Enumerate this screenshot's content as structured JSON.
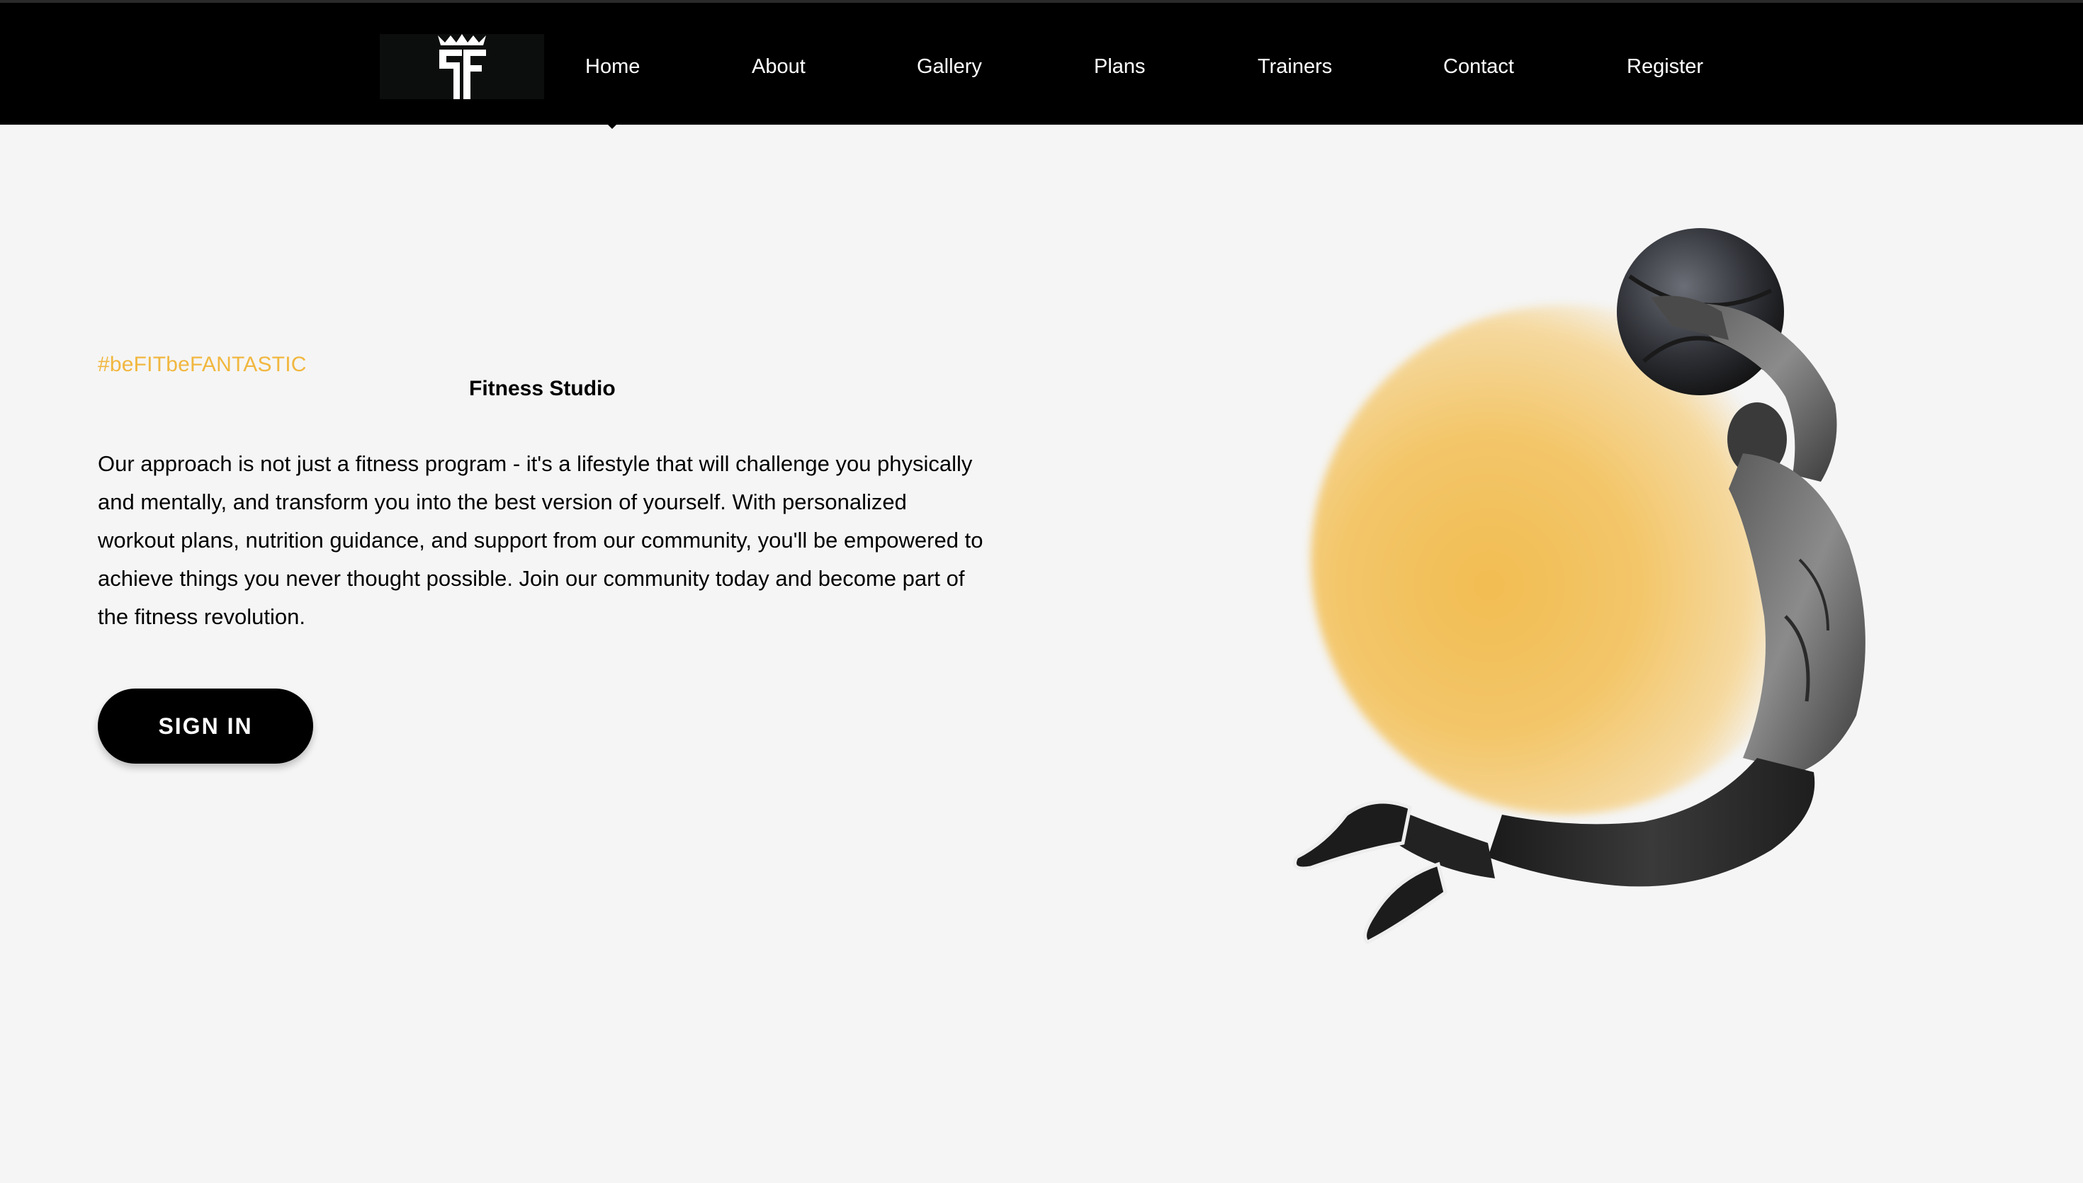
{
  "nav": {
    "items": [
      {
        "label": "Home",
        "active": true
      },
      {
        "label": "About",
        "active": false
      },
      {
        "label": "Gallery",
        "active": false
      },
      {
        "label": "Plans",
        "active": false
      },
      {
        "label": "Trainers",
        "active": false
      },
      {
        "label": "Contact",
        "active": false
      },
      {
        "label": "Register",
        "active": false
      }
    ]
  },
  "hero": {
    "tagline": "#beFITbeFANTASTIC",
    "subtitle": "Fitness Studio",
    "description": "Our approach is not just a fitness program - it's a lifestyle that will challenge you physically and mentally, and transform you into the best version of yourself. With personalized workout plans, nutrition guidance, and support from our community, you'll be empowered to achieve things you never thought possible. Join our community today and become part of the fitness revolution.",
    "button_label": "SIGN IN",
    "image_subject": "athlete-jumping-with-medicine-ball"
  },
  "colors": {
    "nav_background": "#000000",
    "page_background": "#f5f5f5",
    "accent": "#f1b73f",
    "button_background": "#000000",
    "button_text": "#ffffff"
  },
  "icons": {
    "logo": "crown-ff-logo-icon",
    "active_indicator": "caret-down-icon"
  }
}
